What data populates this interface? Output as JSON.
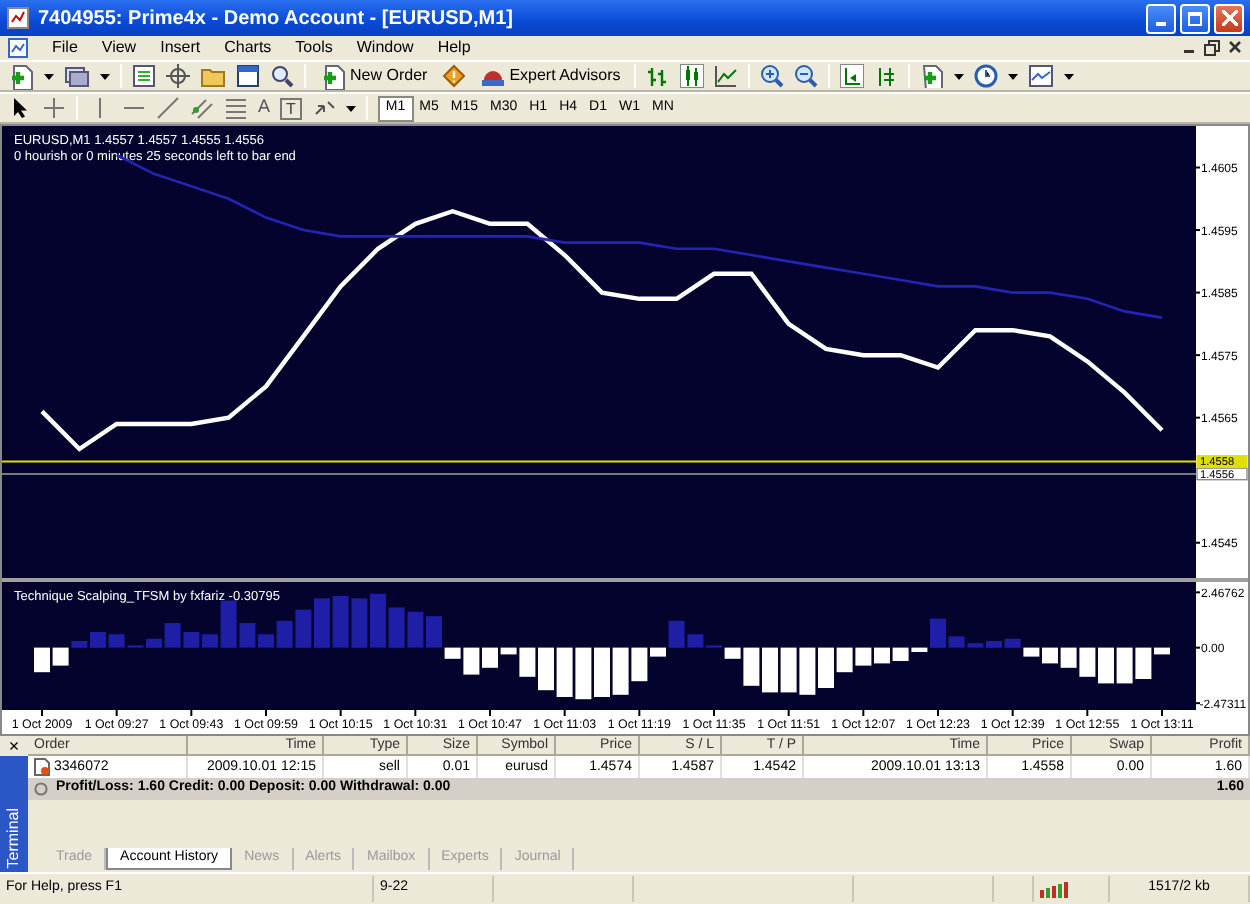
{
  "window": {
    "title": "7404955: Prime4x - Demo Account - [EURUSD,M1]"
  },
  "menu": [
    "File",
    "View",
    "Insert",
    "Charts",
    "Tools",
    "Window",
    "Help"
  ],
  "toolbar": {
    "buttons": [
      "New Order",
      "Expert Advisors"
    ]
  },
  "drawing_toolbar": {
    "glyphs": [
      "A",
      "T"
    ],
    "periods": [
      {
        "label": "M1",
        "selected": true
      },
      {
        "label": "M5",
        "selected": false
      },
      {
        "label": "M15",
        "selected": false
      },
      {
        "label": "M30",
        "selected": false
      },
      {
        "label": "H1",
        "selected": false
      },
      {
        "label": "H4",
        "selected": false
      },
      {
        "label": "D1",
        "selected": false
      },
      {
        "label": "W1",
        "selected": false
      },
      {
        "label": "MN",
        "selected": false
      }
    ]
  },
  "chart": {
    "chart_data": {
      "type": "line",
      "title": "EURUSD,M1  1.4557 1.4557 1.4555 1.4556",
      "categories": [
        null,
        null,
        null,
        null,
        null,
        null,
        null,
        null,
        null,
        null,
        null,
        null,
        null,
        null,
        null,
        null,
        null,
        null,
        null,
        null,
        null,
        null,
        null,
        null,
        null,
        null,
        null,
        null,
        null,
        null,
        null
      ],
      "ylim": [
        1.454,
        1.4611
      ],
      "yticks": [
        {
          "value": 1.4605,
          "label": "1.4605"
        },
        {
          "value": 1.4595,
          "label": "1.4595"
        },
        {
          "value": 1.4585,
          "label": "1.4585"
        },
        {
          "value": 1.4575,
          "label": "1.4575"
        },
        {
          "value": 1.4565,
          "label": "1.4565"
        },
        {
          "value": 1.4545,
          "label": "1.4545"
        }
      ],
      "series": [
        {
          "color": "#ffffff",
          "values": [
            1.4566,
            1.456,
            1.4564,
            1.4564,
            1.4564,
            1.4565,
            1.457,
            1.4578,
            1.4586,
            1.4592,
            1.4596,
            1.4598,
            1.4596,
            1.4596,
            1.4591,
            1.4585,
            1.4584,
            1.4584,
            1.4588,
            1.4588,
            1.458,
            1.4576,
            1.4575,
            1.4575,
            1.4573,
            1.4579,
            1.4579,
            1.4578,
            1.4574,
            1.4569,
            1.4563
          ]
        },
        {
          "color": "#2424b4",
          "values": [
            null,
            null,
            1.4607,
            1.4604,
            1.4602,
            1.46,
            1.4597,
            1.4595,
            1.4594,
            1.4594,
            1.4594,
            1.4594,
            1.4594,
            1.4594,
            1.4593,
            1.4593,
            1.4593,
            1.4592,
            1.4592,
            1.4591,
            1.459,
            1.4589,
            1.4588,
            1.4587,
            1.4586,
            1.4586,
            1.4585,
            1.4585,
            1.4584,
            1.4582,
            1.4581
          ]
        }
      ],
      "annotations": [
        "0 hourish or 0 minutes 25 seconds left to bar end"
      ],
      "ref_lines": [
        {
          "axis": "y",
          "value": 1.4558,
          "label": "1.4558",
          "color": "#e0e000"
        },
        {
          "axis": "y",
          "value": 1.4556,
          "label": "1.4556",
          "color": "#7a7a7a"
        }
      ]
    }
  },
  "indicator": {
    "chart_data": {
      "type": "bar",
      "title": "Technique Scalping_TFSM by fxfariz -0.30795",
      "categories": [
        "1 Oct 2009",
        null,
        null,
        null,
        "1 Oct 09:27",
        null,
        null,
        null,
        "1 Oct 09:43",
        null,
        null,
        null,
        "1 Oct 09:59",
        null,
        null,
        null,
        "1 Oct 10:15",
        null,
        null,
        null,
        "1 Oct 10:31",
        null,
        null,
        null,
        "1 Oct 10:47",
        null,
        null,
        null,
        "1 Oct 11:03",
        null,
        null,
        null,
        "1 Oct 11:19",
        null,
        null,
        null,
        "1 Oct 11:35",
        null,
        null,
        null,
        "1 Oct 11:51",
        null,
        null,
        null,
        "1 Oct 12:07",
        null,
        null,
        null,
        "1 Oct 12:23",
        null,
        null,
        null,
        "1 Oct 12:39",
        null,
        null,
        null,
        "1 Oct 12:55",
        null,
        null,
        null,
        "1 Oct 13:11"
      ],
      "ylim": [
        -2.6,
        2.75
      ],
      "stacked": true,
      "yticks": [
        {
          "value": 2.46762,
          "label": "2.46762"
        },
        {
          "value": 0,
          "label": "0.00"
        },
        {
          "value": -2.47311,
          "label": "-2.47311"
        }
      ],
      "series": [
        {
          "color": "#1e1ea6",
          "values": [
            null,
            null,
            0.3,
            0.7,
            0.6,
            0.1,
            0.4,
            1.1,
            0.7,
            0.6,
            2.1,
            1.1,
            0.6,
            1.2,
            1.7,
            2.2,
            2.3,
            2.2,
            2.4,
            1.8,
            1.6,
            1.4,
            null,
            null,
            null,
            null,
            null,
            null,
            null,
            null,
            null,
            null,
            null,
            null,
            1.2,
            0.6,
            0.1,
            null,
            null,
            null,
            null,
            null,
            null,
            null,
            null,
            null,
            null,
            null,
            1.3,
            0.5,
            0.2,
            0.3,
            0.4,
            null,
            null,
            null,
            null,
            null,
            null,
            null,
            null
          ]
        },
        {
          "color": "#ffffff",
          "values": [
            -1.1,
            -0.8,
            null,
            null,
            null,
            null,
            null,
            null,
            null,
            null,
            null,
            null,
            null,
            null,
            null,
            null,
            null,
            null,
            null,
            null,
            null,
            null,
            -0.5,
            -1.2,
            -0.9,
            -0.3,
            -1.3,
            -1.9,
            -2.2,
            -2.3,
            -2.2,
            -2.1,
            -1.5,
            -0.4,
            null,
            null,
            null,
            -0.5,
            -1.7,
            -2.0,
            -2.0,
            -2.1,
            -1.8,
            -1.1,
            -0.8,
            -0.7,
            -0.6,
            -0.2,
            null,
            null,
            null,
            null,
            null,
            -0.4,
            -0.7,
            -0.9,
            -1.3,
            -1.6,
            -1.6,
            -1.4,
            -0.3
          ]
        }
      ]
    }
  },
  "terminal": {
    "title": "Terminal",
    "close": "×",
    "columns": [
      "Order",
      "Time",
      "Type",
      "Size",
      "Symbol",
      "Price",
      "S / L",
      "T / P",
      "Time",
      "Price",
      "Swap",
      "Profit"
    ],
    "rows": [
      {
        "cells": [
          "3346072",
          "2009.10.01 12:15",
          "sell",
          "0.01",
          "eurusd",
          "1.4574",
          "1.4587",
          "1.4542",
          "2009.10.01 13:13",
          "1.4558",
          "0.00",
          "1.60"
        ]
      }
    ],
    "summary": {
      "text": "Profit/Loss: 1.60  Credit: 0.00  Deposit: 0.00  Withdrawal: 0.00",
      "total": "1.60"
    },
    "tabs": [
      {
        "label": "Trade",
        "selected": false
      },
      {
        "label": "Account History",
        "selected": true
      },
      {
        "label": "News",
        "selected": false
      },
      {
        "label": "Alerts",
        "selected": false
      },
      {
        "label": "Mailbox",
        "selected": false
      },
      {
        "label": "Experts",
        "selected": false
      },
      {
        "label": "Journal",
        "selected": false
      }
    ]
  },
  "status_bar": [
    "For Help, press F1",
    "9-22",
    "1517/2 kb"
  ]
}
